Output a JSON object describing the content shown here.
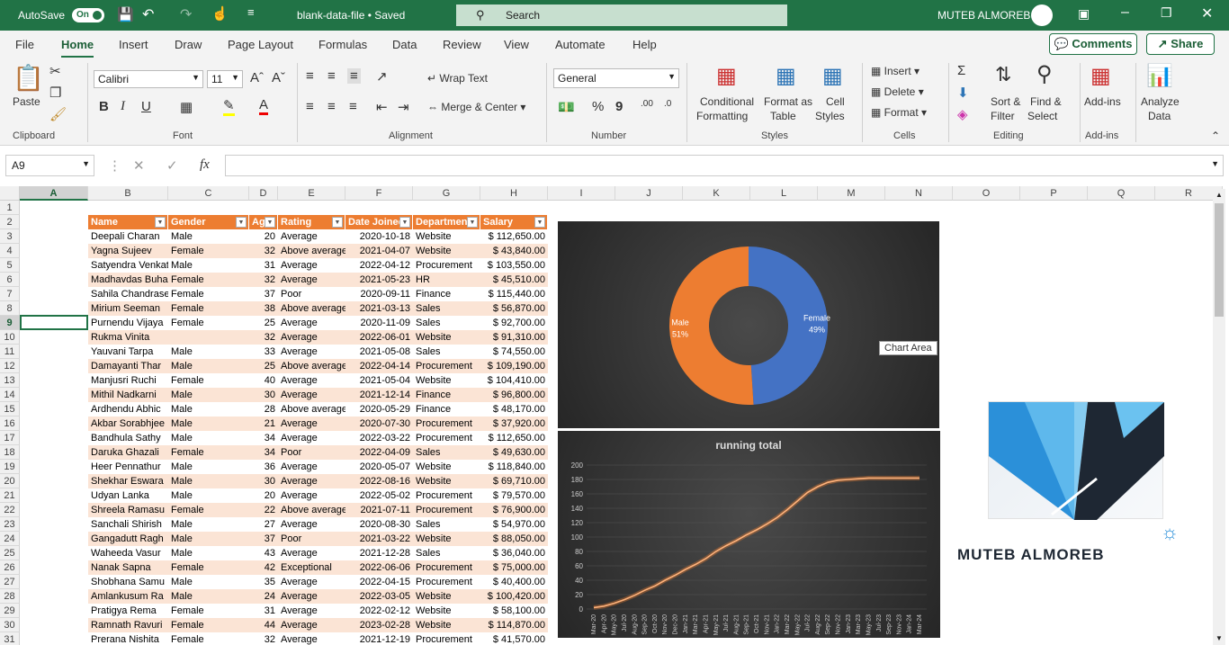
{
  "app": {
    "autosave": "AutoSave",
    "autosave_state": "On",
    "filename": "blank-data-file • Saved",
    "search": "Search",
    "user": "MUTEB ALMOREB"
  },
  "tabs": [
    "File",
    "Home",
    "Insert",
    "Draw",
    "Page Layout",
    "Formulas",
    "Data",
    "Review",
    "View",
    "Automate",
    "Help"
  ],
  "actions": {
    "comments": "Comments",
    "share": "Share"
  },
  "ribbon": {
    "paste": "Paste",
    "font_name": "Calibri",
    "font_size": "11",
    "wrap": "Wrap Text",
    "merge": "Merge & Center",
    "number_format": "General",
    "cond1": "Conditional",
    "cond2": "Formatting",
    "fmt1": "Format as",
    "fmt2": "Table",
    "cs1": "Cell",
    "cs2": "Styles",
    "insert": "Insert",
    "delete": "Delete",
    "format": "Format",
    "sort1": "Sort &",
    "sort2": "Filter",
    "find1": "Find &",
    "find2": "Select",
    "addins1": "Add-ins",
    "an1": "Analyze",
    "an2": "Data",
    "groups": {
      "clipboard": "Clipboard",
      "font": "Font",
      "alignment": "Alignment",
      "number": "Number",
      "styles": "Styles",
      "cells": "Cells",
      "editing": "Editing",
      "addins": "Add-ins"
    }
  },
  "formula": {
    "namebox": "A9",
    "fx": "fx"
  },
  "columns": [
    "A",
    "B",
    "C",
    "D",
    "E",
    "F",
    "G",
    "H",
    "I",
    "J",
    "K",
    "L",
    "M",
    "N",
    "O",
    "P",
    "Q",
    "R"
  ],
  "headers": [
    "Name",
    "Gender",
    "Age",
    "Rating",
    "Date Joined",
    "Department",
    "Salary"
  ],
  "rows": [
    [
      "Deepali Charan",
      "Male",
      "20",
      "Average",
      "2020-10-18",
      "Website",
      "$ 112,650.00"
    ],
    [
      "Yagna Sujeev",
      "Female",
      "32",
      "Above average",
      "2021-04-07",
      "Website",
      "$ 43,840.00"
    ],
    [
      "Satyendra Venkat",
      "Male",
      "31",
      "Average",
      "2022-04-12",
      "Procurement",
      "$ 103,550.00"
    ],
    [
      "Madhavdas Buhar",
      "Female",
      "32",
      "Average",
      "2021-05-23",
      "HR",
      "$ 45,510.00"
    ],
    [
      "Sahila Chandrasekhar",
      "Female",
      "37",
      "Poor",
      "2020-09-11",
      "Finance",
      "$ 115,440.00"
    ],
    [
      "Mirium Seeman",
      "Female",
      "38",
      "Above average",
      "2021-03-13",
      "Sales",
      "$ 56,870.00"
    ],
    [
      "Purnendu Vijaya",
      "Female",
      "25",
      "Average",
      "2020-11-09",
      "Sales",
      "$ 92,700.00"
    ],
    [
      "Rukma Vinita",
      "",
      "32",
      "Average",
      "2022-06-01",
      "Website",
      "$ 91,310.00"
    ],
    [
      "Yauvani Tarpa",
      "Male",
      "33",
      "Average",
      "2021-05-08",
      "Sales",
      "$ 74,550.00"
    ],
    [
      "Damayanti Thar",
      "Male",
      "25",
      "Above average",
      "2022-04-14",
      "Procurement",
      "$ 109,190.00"
    ],
    [
      "Manjusri Ruchi",
      "Female",
      "40",
      "Average",
      "2021-05-04",
      "Website",
      "$ 104,410.00"
    ],
    [
      "Mithil Nadkarni",
      "Male",
      "30",
      "Average",
      "2021-12-14",
      "Finance",
      "$ 96,800.00"
    ],
    [
      "Ardhendu Abhic",
      "Male",
      "28",
      "Above average",
      "2020-05-29",
      "Finance",
      "$ 48,170.00"
    ],
    [
      "Akbar Sorabhjee",
      "Male",
      "21",
      "Average",
      "2020-07-30",
      "Procurement",
      "$ 37,920.00"
    ],
    [
      "Bandhula Sathy",
      "Male",
      "34",
      "Average",
      "2022-03-22",
      "Procurement",
      "$ 112,650.00"
    ],
    [
      "Daruka Ghazali",
      "Female",
      "34",
      "Poor",
      "2022-04-09",
      "Sales",
      "$ 49,630.00"
    ],
    [
      "Heer Pennathur",
      "Male",
      "36",
      "Average",
      "2020-05-07",
      "Website",
      "$ 118,840.00"
    ],
    [
      "Shekhar Eswara",
      "Male",
      "30",
      "Average",
      "2022-08-16",
      "Website",
      "$ 69,710.00"
    ],
    [
      "Udyan Lanka",
      "Male",
      "20",
      "Average",
      "2022-05-02",
      "Procurement",
      "$ 79,570.00"
    ],
    [
      "Shreela Ramasu",
      "Female",
      "22",
      "Above average",
      "2021-07-11",
      "Procurement",
      "$ 76,900.00"
    ],
    [
      "Sanchali Shirish",
      "Male",
      "27",
      "Average",
      "2020-08-30",
      "Sales",
      "$ 54,970.00"
    ],
    [
      "Gangadutt Ragh",
      "Male",
      "37",
      "Poor",
      "2021-03-22",
      "Website",
      "$ 88,050.00"
    ],
    [
      "Waheeda Vasur",
      "Male",
      "43",
      "Average",
      "2021-12-28",
      "Sales",
      "$ 36,040.00"
    ],
    [
      "Nanak Sapna",
      "Female",
      "42",
      "Exceptional",
      "2022-06-06",
      "Procurement",
      "$ 75,000.00"
    ],
    [
      "Shobhana Samu",
      "Male",
      "35",
      "Average",
      "2022-04-15",
      "Procurement",
      "$ 40,400.00"
    ],
    [
      "Amlankusum Ra",
      "Male",
      "24",
      "Average",
      "2022-03-05",
      "Website",
      "$ 100,420.00"
    ],
    [
      "Pratigya Rema",
      "Female",
      "31",
      "Average",
      "2022-02-12",
      "Website",
      "$ 58,100.00"
    ],
    [
      "Ramnath Ravuri",
      "Female",
      "44",
      "Average",
      "2023-02-28",
      "Website",
      "$ 114,870.00"
    ],
    [
      "Prerana Nishita",
      "Female",
      "32",
      "Average",
      "2021-12-19",
      "Procurement",
      "$ 41,570.00"
    ]
  ],
  "tooltip": "Chart Area",
  "logo_text": "MUTEB ALMOREB",
  "chart_data": [
    {
      "type": "pie",
      "variant": "donut",
      "categories": [
        "Male",
        "Female"
      ],
      "values": [
        51,
        49
      ],
      "labels": [
        "Male\n51%",
        "Female\n49%"
      ],
      "colors": [
        "#ed7d31",
        "#4472c4"
      ]
    },
    {
      "type": "line",
      "title": "running total",
      "x": [
        "Mar-20",
        "Apr-20",
        "May-20",
        "Jul-20",
        "Aug-20",
        "Sep-20",
        "Oct-20",
        "Nov-20",
        "Dec-20",
        "Jan-21",
        "Mar-21",
        "Apr-21",
        "May-21",
        "Jul-21",
        "Aug-21",
        "Sep-21",
        "Oct-21",
        "Nov-21",
        "Jan-22",
        "Mar-22",
        "May-22",
        "Jul-22",
        "Aug-22",
        "Sep-22",
        "Nov-22",
        "Jan-23",
        "Mar-23",
        "May-23",
        "Jul-23",
        "Sep-23",
        "Nov-23",
        "Jan-24",
        "Mar-24"
      ],
      "values": [
        2,
        4,
        8,
        13,
        19,
        26,
        32,
        40,
        47,
        55,
        62,
        70,
        80,
        88,
        95,
        103,
        110,
        118,
        127,
        138,
        150,
        162,
        170,
        176,
        179,
        180,
        181,
        182,
        182,
        182,
        182,
        182,
        182
      ],
      "yticks": [
        0,
        20,
        40,
        60,
        80,
        100,
        120,
        140,
        160,
        180,
        200
      ],
      "ylim": [
        0,
        200
      ],
      "color": "#ed7d31"
    }
  ]
}
